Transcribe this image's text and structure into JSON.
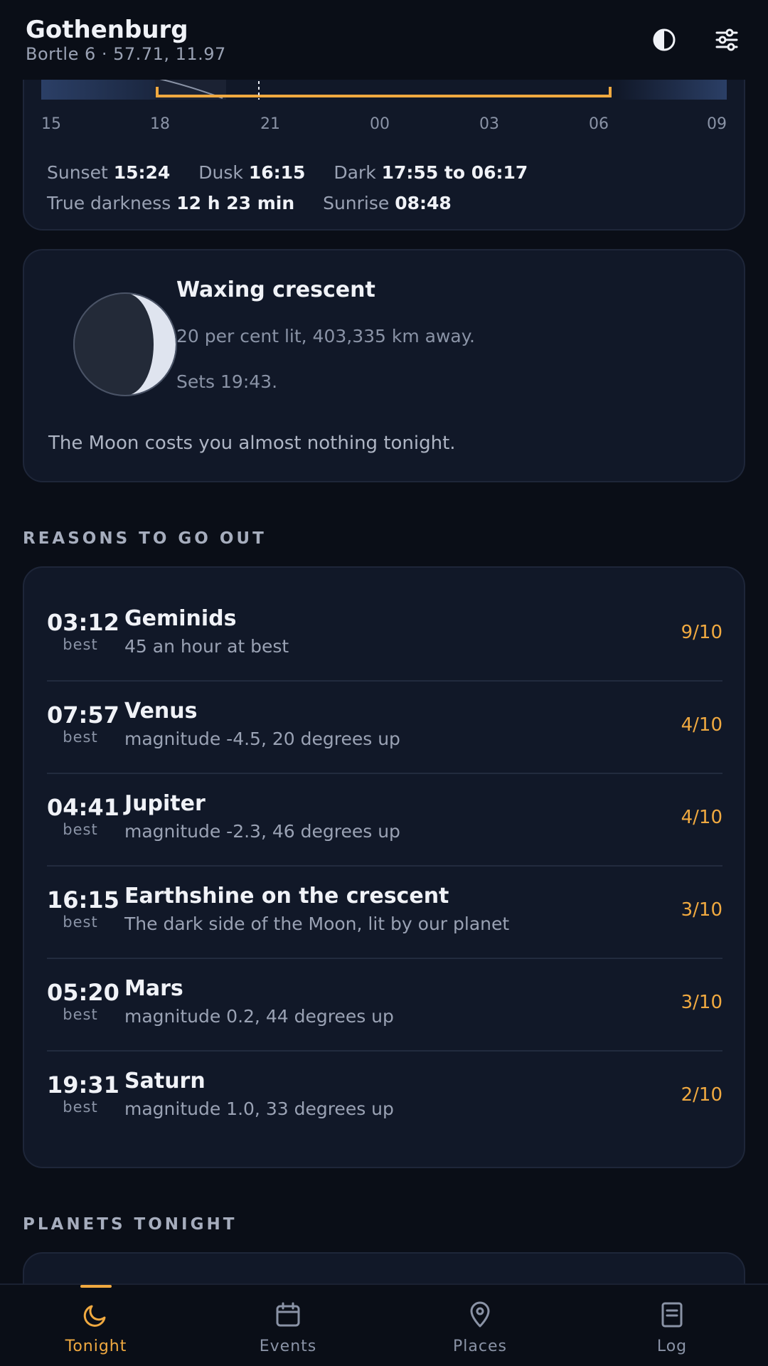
{
  "header": {
    "city": "Gothenburg",
    "subtitle": "Bortle 6 · 57.71, 11.97",
    "icons": [
      "contrast-icon",
      "sliders-icon"
    ]
  },
  "darkness": {
    "ticks": [
      "15",
      "18",
      "21",
      "00",
      "03",
      "06",
      "09"
    ],
    "sunset_label": "Sunset",
    "sunset": "15:24",
    "dusk_label": "Dusk",
    "dusk": "16:15",
    "dark_label": "Dark",
    "dark": "17:55 to 06:17",
    "true_darkness_label": "True darkness",
    "true_darkness": "12 h 23 min",
    "sunrise_label": "Sunrise",
    "sunrise": "08:48",
    "colors": {
      "accent": "#f0a940",
      "twilight": "#2b3f66"
    }
  },
  "moon": {
    "title": "Waxing crescent",
    "line1": "20 per cent lit, 403,335 km away.",
    "line2": "Sets 19:43.",
    "footer": "The Moon costs you almost nothing tonight.",
    "illumination": 0.2
  },
  "reasons": {
    "section_title": "REASONS TO GO OUT",
    "items": [
      {
        "time": "03:12",
        "best": "best",
        "name": "Geminids",
        "desc": "45 an hour at best",
        "score": "9/10"
      },
      {
        "time": "07:57",
        "best": "best",
        "name": "Venus",
        "desc": "magnitude -4.5, 20 degrees up",
        "score": "4/10"
      },
      {
        "time": "04:41",
        "best": "best",
        "name": "Jupiter",
        "desc": "magnitude -2.3, 46 degrees up",
        "score": "4/10"
      },
      {
        "time": "16:15",
        "best": "best",
        "name": "Earthshine on the crescent",
        "desc": "The dark side of the Moon, lit by our planet",
        "score": "3/10"
      },
      {
        "time": "05:20",
        "best": "best",
        "name": "Mars",
        "desc": "magnitude 0.2, 44 degrees up",
        "score": "3/10"
      },
      {
        "time": "19:31",
        "best": "best",
        "name": "Saturn",
        "desc": "magnitude 1.0, 33 degrees up",
        "score": "2/10"
      }
    ]
  },
  "planets": {
    "section_title": "PLANETS TONIGHT"
  },
  "nav": {
    "items": [
      {
        "label": "Tonight",
        "icon": "moon-icon",
        "active": true
      },
      {
        "label": "Events",
        "icon": "calendar-icon",
        "active": false
      },
      {
        "label": "Places",
        "icon": "map-pin-icon",
        "active": false
      },
      {
        "label": "Log",
        "icon": "notebook-icon",
        "active": false
      }
    ]
  }
}
